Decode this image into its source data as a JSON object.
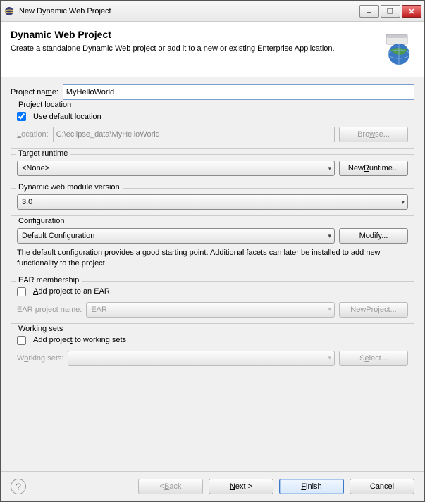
{
  "window": {
    "title": "New Dynamic Web Project"
  },
  "banner": {
    "title": "Dynamic Web Project",
    "description": "Create a standalone Dynamic Web project or add it to a new or existing Enterprise Application."
  },
  "projectName": {
    "label_pre": "Project na",
    "mn": "m",
    "label_post": "e:",
    "value": "MyHelloWorld"
  },
  "location": {
    "group_title": "Project location",
    "useDefault_pre": "Use ",
    "useDefault_mn": "d",
    "useDefault_post": "efault location",
    "useDefault_checked": true,
    "loc_label_pre": "",
    "loc_label_mn": "L",
    "loc_label_post": "ocation:",
    "loc_value": "C:\\eclipse_data\\MyHelloWorld",
    "browse_pre": "Bro",
    "browse_mn": "w",
    "browse_post": "se..."
  },
  "runtime": {
    "group_title": "Target runtime",
    "value": "<None>",
    "new_pre": "New ",
    "new_mn": "R",
    "new_post": "untime..."
  },
  "module": {
    "group_title": "Dynamic web module version",
    "value": "3.0"
  },
  "config": {
    "group_title": "Configuration",
    "value": "Default Configuration",
    "modify_pre": "Mod",
    "modify_mn": "i",
    "modify_post": "fy...",
    "hint": "The default configuration provides a good starting point. Additional facets can later be installed to add new functionality to the project."
  },
  "ear": {
    "group_title": "EAR membership",
    "add_pre": "",
    "add_mn": "A",
    "add_post": "dd project to an EAR",
    "add_checked": false,
    "proj_label_pre": "EA",
    "proj_label_mn": "R",
    "proj_label_post": " project name:",
    "proj_value": "EAR",
    "new_pre": "New ",
    "new_mn": "P",
    "new_post": "roject..."
  },
  "working": {
    "group_title": "Working sets",
    "add_pre": "Add projec",
    "add_mn": "t",
    "add_post": " to working sets",
    "add_checked": false,
    "sets_label_pre": "W",
    "sets_label_mn": "o",
    "sets_label_post": "rking sets:",
    "sets_value": "",
    "select_pre": "S",
    "select_mn": "e",
    "select_post": "lect..."
  },
  "buttons": {
    "back_pre": "< ",
    "back_mn": "B",
    "back_post": "ack",
    "next_pre": "",
    "next_mn": "N",
    "next_post": "ext >",
    "finish_pre": "",
    "finish_mn": "F",
    "finish_post": "inish",
    "cancel": "Cancel"
  }
}
